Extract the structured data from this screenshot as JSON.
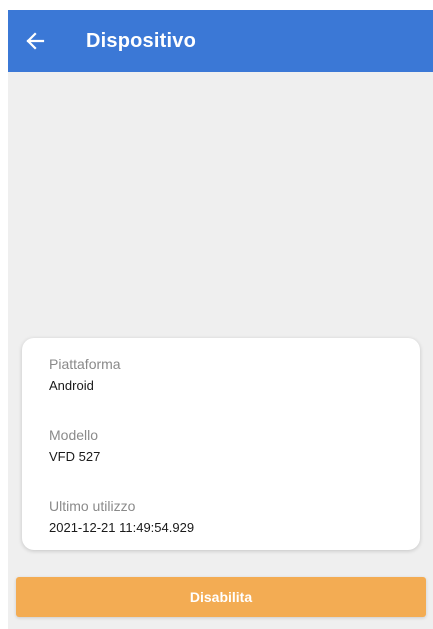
{
  "app_bar": {
    "title": "Dispositivo",
    "back_icon": "arrow-left-icon",
    "background": "#3b78d6"
  },
  "device": {
    "fields": [
      {
        "label": "Piattaforma",
        "value": "Android"
      },
      {
        "label": "Modello",
        "value": "VFD 527"
      },
      {
        "label": "Ultimo utilizzo",
        "value": "2021-12-21 11:49:54.929"
      }
    ]
  },
  "actions": {
    "disable_label": "Disabilita",
    "disable_color": "#f3ac53"
  }
}
